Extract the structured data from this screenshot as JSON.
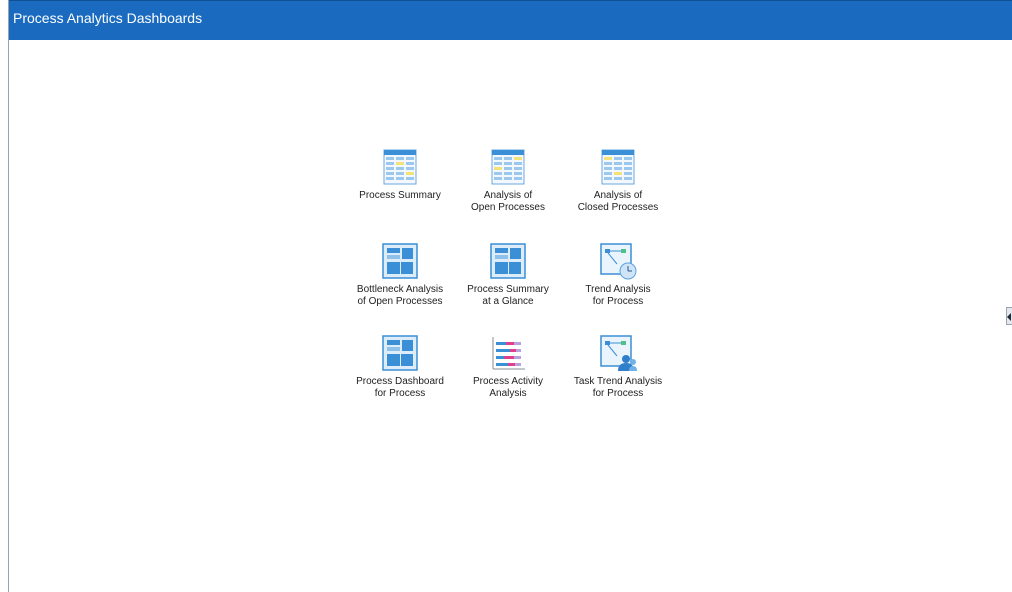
{
  "header": {
    "title": "Process Analytics Dashboards"
  },
  "colors": {
    "header_bg": "#1a6bbf",
    "icon_blue": "#3b8fd6",
    "icon_light": "#cfe5f7"
  },
  "tiles": [
    {
      "label": "Process Summary",
      "icon": "table-report-icon"
    },
    {
      "label": "Analysis of\nOpen Processes",
      "icon": "table-report-icon"
    },
    {
      "label": "Analysis of\nClosed Processes",
      "icon": "table-report-icon"
    },
    {
      "label": "Bottleneck Analysis\nof Open Processes",
      "icon": "dashboard-layout-icon"
    },
    {
      "label": "Process Summary\nat a Glance",
      "icon": "dashboard-layout-icon"
    },
    {
      "label": "Trend Analysis\nfor Process",
      "icon": "trend-clock-icon"
    },
    {
      "label": "Process Dashboard\nfor Process",
      "icon": "dashboard-layout-icon"
    },
    {
      "label": "Process Activity\nAnalysis",
      "icon": "bar-list-icon"
    },
    {
      "label": "Task Trend Analysis\nfor Process",
      "icon": "trend-user-icon"
    }
  ]
}
